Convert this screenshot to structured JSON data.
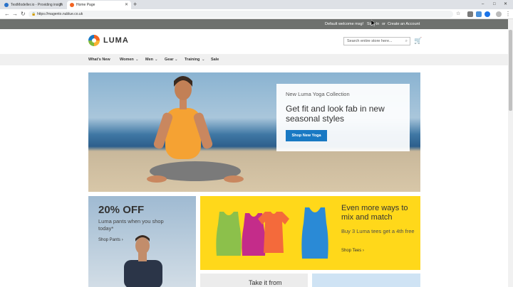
{
  "browser": {
    "tabs": [
      {
        "label": "TestModeller.io - Providing insigh",
        "active": false
      },
      {
        "label": "Home Page",
        "active": true
      }
    ],
    "new_tab_symbol": "+",
    "url": "https://magento.nublue.co.uk",
    "controls": {
      "minimize": "–",
      "maximize": "□",
      "close": "✕"
    },
    "nav": {
      "back": "←",
      "forward": "→",
      "reload": "↻"
    }
  },
  "site": {
    "topbar": {
      "welcome": "Default welcome msg!",
      "sign_in": "Sign In",
      "or": "or",
      "create_account": "Create an Account"
    },
    "logo_text": "LUMA",
    "search_placeholder": "Search entire store here...",
    "nav": [
      {
        "label": "What's New",
        "dropdown": false
      },
      {
        "label": "Women",
        "dropdown": true
      },
      {
        "label": "Men",
        "dropdown": true
      },
      {
        "label": "Gear",
        "dropdown": true
      },
      {
        "label": "Training",
        "dropdown": true
      },
      {
        "label": "Sale",
        "dropdown": false
      }
    ],
    "hero": {
      "subtitle": "New Luma Yoga Collection",
      "title": "Get fit and look fab in new seasonal styles",
      "button": "Shop New Yoga"
    },
    "promo_pants": {
      "title": "20% OFF",
      "text": "Luma pants when you shop today*",
      "link": "Shop Pants ›"
    },
    "promo_tees": {
      "title": "Even more ways to mix and match",
      "text": "Buy 3 Luma tees get a 4th free",
      "link": "Shop Tees ›"
    },
    "card_bottom": {
      "text": "Take it from"
    }
  },
  "colors": {
    "topbar": "#6e716e",
    "accent": "#1979c3",
    "promo_yellow": "#ffd81a"
  }
}
